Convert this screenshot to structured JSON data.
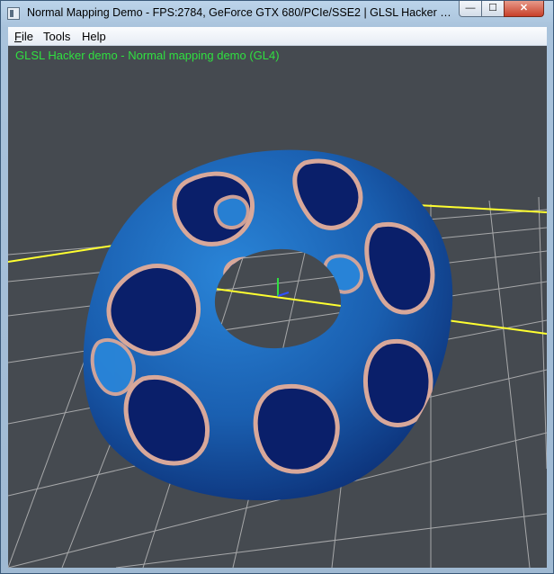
{
  "window": {
    "title": "Normal Mapping Demo - FPS:2784, GeForce GTX 680/PCIe/SSE2 | GLSL Hacker (Windo...",
    "minimize_glyph": "—",
    "maximize_glyph": "☐",
    "close_glyph": "✕"
  },
  "menu": {
    "items": [
      "File",
      "Tools",
      "Help"
    ]
  },
  "viewport": {
    "demo_title": "GLSL Hacker demo - Normal mapping demo (GL4)",
    "colors": {
      "background": "#454a50",
      "grid": "#c8c8c8",
      "axis": "#ffff30",
      "torus_light": "#1f6fbf",
      "torus_dark": "#0a1f6a",
      "ridge": "#d8a89a",
      "text": "#30e040"
    }
  }
}
